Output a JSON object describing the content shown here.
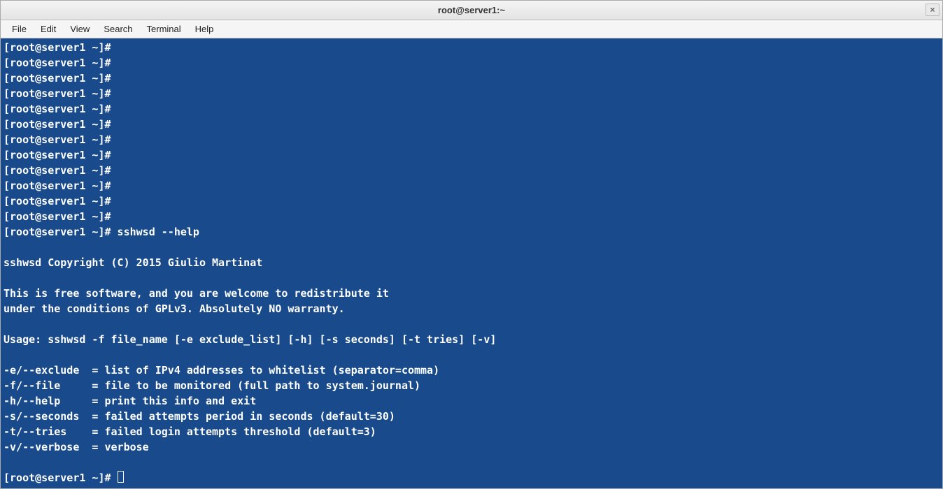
{
  "window": {
    "title": "root@server1:~",
    "close_label": "×"
  },
  "menubar": {
    "items": [
      "File",
      "Edit",
      "View",
      "Search",
      "Terminal",
      "Help"
    ]
  },
  "terminal": {
    "prompt": "[root@server1 ~]#",
    "empty_prompt_count": 12,
    "command": "sshwsd --help",
    "output_lines": [
      "",
      "sshwsd Copyright (C) 2015 Giulio Martinat",
      "",
      "This is free software, and you are welcome to redistribute it",
      "under the conditions of GPLv3. Absolutely NO warranty.",
      "",
      "Usage: sshwsd -f file_name [-e exclude_list] [-h] [-s seconds] [-t tries] [-v]",
      "",
      "-e/--exclude  = list of IPv4 addresses to whitelist (separator=comma)",
      "-f/--file     = file to be monitored (full path to system.journal)",
      "-h/--help     = print this info and exit",
      "-s/--seconds  = failed attempts period in seconds (default=30)",
      "-t/--tries    = failed login attempts threshold (default=3)",
      "-v/--verbose  = verbose",
      ""
    ]
  }
}
